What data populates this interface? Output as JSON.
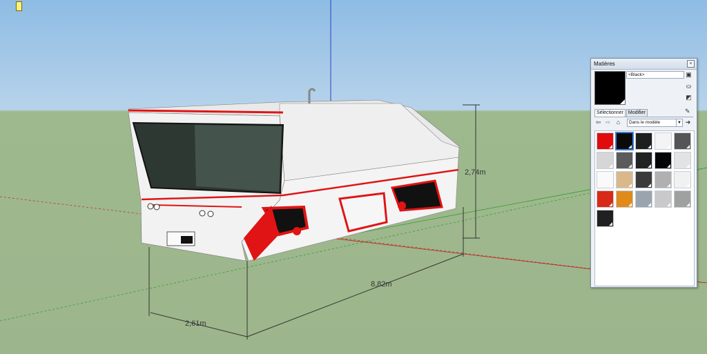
{
  "viewport": {
    "axis_colors": {
      "blue": "#2b3dcc",
      "red": "#c21a1a",
      "green": "#2fa12f"
    },
    "dimensions": {
      "height": "2,74m",
      "length": "8,82m",
      "width": "2,61m"
    },
    "model_colors": {
      "body": "#f2f2f2",
      "accent": "#e01414",
      "glass": "#3c4a44"
    }
  },
  "materials_panel": {
    "title": "Matières",
    "close_icon": "close-icon",
    "material_name": "<Black>",
    "tabs": [
      "Sélectionner",
      "Modifier"
    ],
    "collection": "Dans le modèle",
    "swatches": [
      {
        "color": "#e00b0b",
        "name": "red"
      },
      {
        "color": "#0a0a0a",
        "name": "black",
        "selected": true
      },
      {
        "color": "#1e1e1e",
        "name": "dark-gray"
      },
      {
        "color": "#f4f4f4",
        "name": "white"
      },
      {
        "color": "#555555",
        "name": "striped"
      },
      {
        "color": "#d6d6d6",
        "name": "light-gray"
      },
      {
        "color": "#5b5b5b",
        "name": "gray"
      },
      {
        "color": "#222222",
        "name": "charcoal"
      },
      {
        "color": "#050505",
        "name": "black-2"
      },
      {
        "color": "#e3e3e3",
        "name": "pale-gray"
      },
      {
        "color": "#fafafa",
        "name": "white-2"
      },
      {
        "color": "#d9b98a",
        "name": "wood"
      },
      {
        "color": "#3a3a3a",
        "name": "graphite"
      },
      {
        "color": "#b0b0b0",
        "name": "silver"
      },
      {
        "color": "#f1f1f1",
        "name": "off-white"
      },
      {
        "color": "#d82a16",
        "name": "red-glass"
      },
      {
        "color": "#e08a1a",
        "name": "orange-glass"
      },
      {
        "color": "#9aa4ae",
        "name": "clear-glass"
      },
      {
        "color": "#c9c9c9",
        "name": "metal"
      },
      {
        "color": "#a0a0a0",
        "name": "gray-diag"
      },
      {
        "color": "#202020",
        "name": "black-diag"
      }
    ]
  }
}
